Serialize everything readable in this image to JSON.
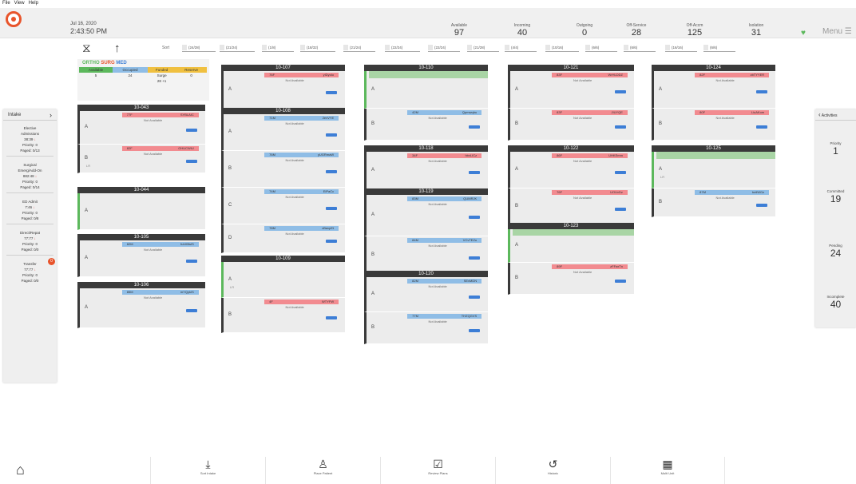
{
  "menubar": {
    "file": "File",
    "view": "View",
    "help": "Help"
  },
  "header": {
    "date": "Jul 16, 2020",
    "time": "2:43:50 PM",
    "menu_label": "Menu ☰",
    "stats": [
      {
        "label": "Available",
        "value": "97"
      },
      {
        "label": "Incoming",
        "value": "40"
      },
      {
        "label": "Outgoing",
        "value": "0"
      },
      {
        "label": "Off-Service",
        "value": "28"
      },
      {
        "label": "Off-Accm",
        "value": "125"
      },
      {
        "label": "Isolation",
        "value": "31"
      }
    ]
  },
  "toolbar": {
    "sort_label": "Sort",
    "filters": [
      "(24/28)",
      "(21/24)",
      "(1/8)",
      "(18/32)",
      "(21/24)",
      "(22/24)",
      "(22/24)",
      "(21/28)",
      "(4/4)",
      "(10/16)",
      "(6/6)",
      "(6/6)",
      "(16/16)",
      "(6/6)"
    ]
  },
  "census": {
    "ortho": "ORTHO",
    "surg": "SURG",
    "med": "MED",
    "headers": [
      "Available",
      "Occupied",
      "Funded",
      "Reserve"
    ],
    "values": [
      "5",
      "24",
      "Surge",
      "0"
    ],
    "extra": "28 +1",
    "colors": {
      "available": "#5cb85c",
      "occupied": "#8fbde6",
      "funded": "#f0c040",
      "reserve": "#f0c040"
    }
  },
  "rooms": {
    "r043": {
      "name": "10-043",
      "a": {
        "code": "77F",
        "id": "SYBLAIC",
        "status": "Not Available"
      },
      "b": {
        "code": "82F",
        "id": "GHUCWIU",
        "status": "Not Available"
      }
    },
    "r044": {
      "name": "10-044"
    },
    "r105": {
      "name": "10-105",
      "a": {
        "code": "82M",
        "id": "fuhXBsIS",
        "status": "Not Available"
      }
    },
    "r106": {
      "name": "10-106",
      "a": {
        "code": "85M",
        "id": "mYQykIS",
        "status": "Not Available"
      }
    },
    "r107": {
      "name": "10-107",
      "a": {
        "code": "76F",
        "id": "yIDyoIo",
        "status": "Not Available"
      }
    },
    "r108": {
      "name": "10-108",
      "a": {
        "code": "71M",
        "id": "2evVYE",
        "status": "Not Available"
      },
      "b": {
        "code": "76M",
        "id": "yUGRmaW",
        "status": "Not Available"
      },
      "c": {
        "code": "74M",
        "id": "EiPaCc",
        "status": "Not Available"
      },
      "d": {
        "code": "78M",
        "id": "xBavpEt",
        "status": "Not Available"
      }
    },
    "r109": {
      "name": "10-109",
      "b": {
        "code": "4F",
        "id": "WTYFW",
        "status": "Not Available"
      }
    },
    "r110": {
      "name": "10-110",
      "b": {
        "code": "42M",
        "id": "Qpmwqhu",
        "status": "Not Available"
      }
    },
    "r118": {
      "name": "10-118",
      "a": {
        "code": "34F",
        "id": "hbvLICz",
        "status": "Not Available"
      }
    },
    "r119": {
      "name": "10-119",
      "a": {
        "code": "83M",
        "id": "QUMRJK",
        "status": "Not Available"
      },
      "b": {
        "code": "84M",
        "id": "VCvTEZu",
        "status": "Not Available"
      }
    },
    "r120": {
      "name": "10-120",
      "a": {
        "code": "82M",
        "id": "SEvMDN",
        "status": "Not Available"
      },
      "b": {
        "code": "77M",
        "id": "THZQGVS",
        "status": "Not Available"
      }
    },
    "r121": {
      "name": "10-121",
      "a": {
        "code": "83F",
        "id": "WrHLDDZ",
        "status": "Not Available"
      },
      "b": {
        "code": "83F",
        "id": "JIUYQE",
        "status": "Not Available"
      }
    },
    "r122": {
      "name": "10-122",
      "a": {
        "code": "86F",
        "id": "UHKEmm",
        "status": "Not Available"
      },
      "b": {
        "code": "76F",
        "id": "UOUvDz",
        "status": "Not Available"
      }
    },
    "r123": {
      "name": "10-123",
      "b": {
        "code": "89F",
        "id": "zFFwrTn",
        "status": "Not Available"
      }
    },
    "r124": {
      "name": "10-124",
      "a": {
        "code": "82F",
        "id": "zbTYYER",
        "status": "Not Available"
      },
      "b": {
        "code": "80F",
        "id": "LiuAKom",
        "status": "Not Available"
      }
    },
    "r125": {
      "name": "10-125",
      "b": {
        "code": "87M",
        "id": "beilWGz",
        "status": "Not Available"
      }
    }
  },
  "left": {
    "title": "Intake",
    "sections": [
      {
        "l1": "Elective",
        "l2": "Admissions",
        "time": "38:39",
        "prio": "Priority: 0",
        "paged": "Paged: 0/13"
      },
      {
        "l1": "Surgical",
        "l2": "Emerg/Add-On",
        "time": "882:48",
        "prio": "Priority: 0",
        "paged": "Paged: 0/14"
      },
      {
        "l1": "ED Admit",
        "l2": "",
        "time": "7:46",
        "prio": "Priority: 0",
        "paged": "Paged: 0/8"
      },
      {
        "l1": "Direct/Repat",
        "l2": "",
        "time": "77:77",
        "prio": "Priority: 0",
        "paged": "Paged: 0/0"
      },
      {
        "l1": "Transfer",
        "l2": "",
        "time": "77:77",
        "prio": "Priority: 0",
        "paged": "Paged: 0/0",
        "badge": "0"
      }
    ]
  },
  "right": {
    "title": "Activities",
    "items": [
      {
        "label": "Priority",
        "value": "1"
      },
      {
        "label": "Committed",
        "value": "19"
      },
      {
        "label": "Pending",
        "value": "24"
      },
      {
        "label": "Incomplete",
        "value": "40"
      }
    ]
  },
  "bottomnav": [
    "Sort Intake",
    "Place Patient",
    "Review Plans",
    "Historic",
    "Multi Unit"
  ]
}
